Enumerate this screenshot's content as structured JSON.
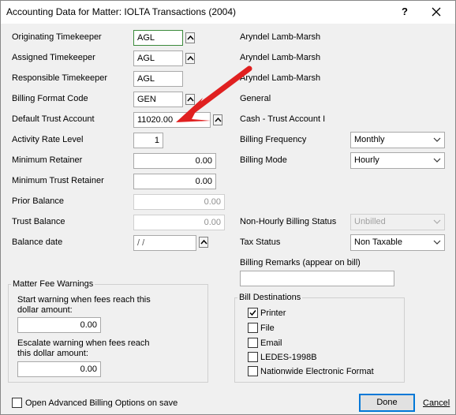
{
  "window": {
    "title": "Accounting Data for Matter: IOLTA Transactions (2004)",
    "help_label": "?"
  },
  "left": {
    "originating_timekeeper": {
      "label": "Originating Timekeeper",
      "value": "AGL"
    },
    "assigned_timekeeper": {
      "label": "Assigned Timekeeper",
      "value": "AGL"
    },
    "responsible_timekeeper": {
      "label": "Responsible Timekeeper",
      "value": "AGL"
    },
    "billing_format_code": {
      "label": "Billing Format Code",
      "value": "GEN"
    },
    "default_trust_account": {
      "label": "Default Trust Account",
      "value": "11020.00"
    },
    "activity_rate_level": {
      "label": "Activity Rate Level",
      "value": "1"
    },
    "minimum_retainer": {
      "label": "Minimum Retainer",
      "value": "0.00"
    },
    "minimum_trust_retainer": {
      "label": "Minimum Trust Retainer",
      "value": "0.00"
    },
    "prior_balance": {
      "label": "Prior Balance",
      "value": "0.00"
    },
    "trust_balance": {
      "label": "Trust Balance",
      "value": "0.00"
    },
    "balance_date": {
      "label": "Balance date",
      "value": "  /  /"
    }
  },
  "right": {
    "originating_name": "Aryndel Lamb-Marsh",
    "assigned_name": "Aryndel Lamb-Marsh",
    "responsible_name": "Aryndel Lamb-Marsh",
    "billing_format_name": "General",
    "trust_account_name": "Cash - Trust Account I",
    "billing_frequency": {
      "label": "Billing Frequency",
      "value": "Monthly"
    },
    "billing_mode": {
      "label": "Billing Mode",
      "value": "Hourly"
    },
    "non_hourly_billing_status": {
      "label": "Non-Hourly Billing Status",
      "value": "Unbilled"
    },
    "tax_status": {
      "label": "Tax Status",
      "value": "Non Taxable"
    },
    "billing_remarks": {
      "label": "Billing Remarks (appear on bill)",
      "value": ""
    }
  },
  "fee_warnings": {
    "title": "Matter Fee Warnings",
    "start_label_1": "Start warning when fees reach this",
    "start_label_2": "dollar amount:",
    "start_value": "0.00",
    "escalate_label_1": "Escalate warning when fees reach",
    "escalate_label_2": "this dollar amount:",
    "escalate_value": "0.00"
  },
  "bill_destinations": {
    "title": "Bill Destinations",
    "items": [
      {
        "label": "Printer",
        "checked": true
      },
      {
        "label": "File",
        "checked": false
      },
      {
        "label": "Email",
        "checked": false
      },
      {
        "label": "LEDES-1998B",
        "checked": false
      },
      {
        "label": "Nationwide Electronic Format",
        "checked": false
      }
    ]
  },
  "footer": {
    "advanced_label": "Open Advanced Billing Options on save",
    "done_label": "Done",
    "cancel_label": "Cancel"
  },
  "colors": {
    "arrow": "#e02020",
    "default_button_border": "#0078d7",
    "highlight_border": "#3c8b3c"
  },
  "icons": [
    "close-icon",
    "lookup-icon",
    "chevron-down-icon",
    "checkmark-icon",
    "red-arrow"
  ]
}
